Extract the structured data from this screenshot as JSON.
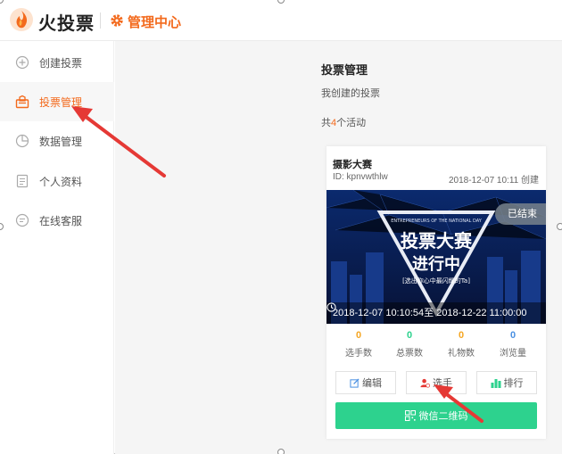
{
  "header": {
    "brand": "火投票",
    "title": "管理中心"
  },
  "sidebar": {
    "items": [
      {
        "label": "创建投票",
        "icon": "plus-circle-icon"
      },
      {
        "label": "投票管理",
        "icon": "ballot-box-icon"
      },
      {
        "label": "数据管理",
        "icon": "pie-chart-icon"
      },
      {
        "label": "个人资料",
        "icon": "document-icon"
      },
      {
        "label": "在线客服",
        "icon": "chat-icon"
      }
    ],
    "active_index": 1
  },
  "main": {
    "title": "投票管理",
    "subtitle": "我创建的投票",
    "count_prefix": "共",
    "count_value": "4",
    "count_suffix": "个活动"
  },
  "card": {
    "title": "摄影大赛",
    "id": "ID: kpnvwthlw",
    "created": "2018-12-07 10:11 创建",
    "status": "已结束",
    "banner_small": "ENTREPRENEURS OF THE NATIONAL DAY",
    "banner_line1": "投票大赛",
    "banner_line2": "进行中",
    "banner_tag": "[选出你心中最闪耀的Ta]",
    "time_range": "2018-12-07 10:10:54至 2018-12-22 11:00:00",
    "stats": [
      {
        "value": "0",
        "label": "选手数",
        "color": "#f5a623"
      },
      {
        "value": "0",
        "label": "总票数",
        "color": "#2dd28e"
      },
      {
        "value": "0",
        "label": "礼物数",
        "color": "#f5a623"
      },
      {
        "value": "0",
        "label": "浏览量",
        "color": "#4a90e2"
      }
    ],
    "btn_edit": "编辑",
    "btn_player": "选手",
    "btn_rank": "排行",
    "btn_qr": "微信二维码"
  },
  "colors": {
    "accent": "#f36a1d",
    "green": "#2dd28e",
    "arrow": "#e53935"
  }
}
